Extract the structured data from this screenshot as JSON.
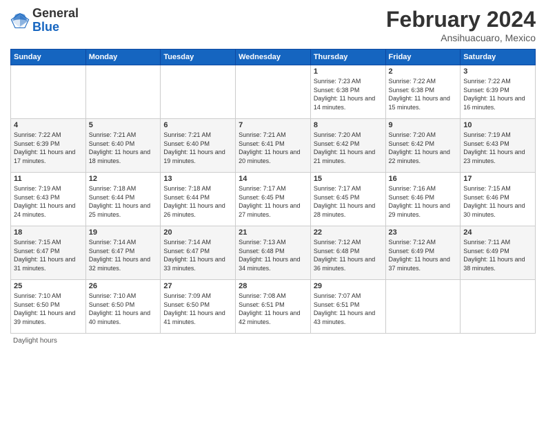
{
  "logo": {
    "general": "General",
    "blue": "Blue"
  },
  "title": "February 2024",
  "subtitle": "Ansihuacuaro, Mexico",
  "days_of_week": [
    "Sunday",
    "Monday",
    "Tuesday",
    "Wednesday",
    "Thursday",
    "Friday",
    "Saturday"
  ],
  "weeks": [
    [
      {
        "num": "",
        "sunrise": "",
        "sunset": "",
        "daylight": ""
      },
      {
        "num": "",
        "sunrise": "",
        "sunset": "",
        "daylight": ""
      },
      {
        "num": "",
        "sunrise": "",
        "sunset": "",
        "daylight": ""
      },
      {
        "num": "",
        "sunrise": "",
        "sunset": "",
        "daylight": ""
      },
      {
        "num": "1",
        "sunrise": "7:23 AM",
        "sunset": "6:38 PM",
        "daylight": "11 hours and 14 minutes."
      },
      {
        "num": "2",
        "sunrise": "7:22 AM",
        "sunset": "6:38 PM",
        "daylight": "11 hours and 15 minutes."
      },
      {
        "num": "3",
        "sunrise": "7:22 AM",
        "sunset": "6:39 PM",
        "daylight": "11 hours and 16 minutes."
      }
    ],
    [
      {
        "num": "4",
        "sunrise": "7:22 AM",
        "sunset": "6:39 PM",
        "daylight": "11 hours and 17 minutes."
      },
      {
        "num": "5",
        "sunrise": "7:21 AM",
        "sunset": "6:40 PM",
        "daylight": "11 hours and 18 minutes."
      },
      {
        "num": "6",
        "sunrise": "7:21 AM",
        "sunset": "6:40 PM",
        "daylight": "11 hours and 19 minutes."
      },
      {
        "num": "7",
        "sunrise": "7:21 AM",
        "sunset": "6:41 PM",
        "daylight": "11 hours and 20 minutes."
      },
      {
        "num": "8",
        "sunrise": "7:20 AM",
        "sunset": "6:42 PM",
        "daylight": "11 hours and 21 minutes."
      },
      {
        "num": "9",
        "sunrise": "7:20 AM",
        "sunset": "6:42 PM",
        "daylight": "11 hours and 22 minutes."
      },
      {
        "num": "10",
        "sunrise": "7:19 AM",
        "sunset": "6:43 PM",
        "daylight": "11 hours and 23 minutes."
      }
    ],
    [
      {
        "num": "11",
        "sunrise": "7:19 AM",
        "sunset": "6:43 PM",
        "daylight": "11 hours and 24 minutes."
      },
      {
        "num": "12",
        "sunrise": "7:18 AM",
        "sunset": "6:44 PM",
        "daylight": "11 hours and 25 minutes."
      },
      {
        "num": "13",
        "sunrise": "7:18 AM",
        "sunset": "6:44 PM",
        "daylight": "11 hours and 26 minutes."
      },
      {
        "num": "14",
        "sunrise": "7:17 AM",
        "sunset": "6:45 PM",
        "daylight": "11 hours and 27 minutes."
      },
      {
        "num": "15",
        "sunrise": "7:17 AM",
        "sunset": "6:45 PM",
        "daylight": "11 hours and 28 minutes."
      },
      {
        "num": "16",
        "sunrise": "7:16 AM",
        "sunset": "6:46 PM",
        "daylight": "11 hours and 29 minutes."
      },
      {
        "num": "17",
        "sunrise": "7:15 AM",
        "sunset": "6:46 PM",
        "daylight": "11 hours and 30 minutes."
      }
    ],
    [
      {
        "num": "18",
        "sunrise": "7:15 AM",
        "sunset": "6:47 PM",
        "daylight": "11 hours and 31 minutes."
      },
      {
        "num": "19",
        "sunrise": "7:14 AM",
        "sunset": "6:47 PM",
        "daylight": "11 hours and 32 minutes."
      },
      {
        "num": "20",
        "sunrise": "7:14 AM",
        "sunset": "6:47 PM",
        "daylight": "11 hours and 33 minutes."
      },
      {
        "num": "21",
        "sunrise": "7:13 AM",
        "sunset": "6:48 PM",
        "daylight": "11 hours and 34 minutes."
      },
      {
        "num": "22",
        "sunrise": "7:12 AM",
        "sunset": "6:48 PM",
        "daylight": "11 hours and 36 minutes."
      },
      {
        "num": "23",
        "sunrise": "7:12 AM",
        "sunset": "6:49 PM",
        "daylight": "11 hours and 37 minutes."
      },
      {
        "num": "24",
        "sunrise": "7:11 AM",
        "sunset": "6:49 PM",
        "daylight": "11 hours and 38 minutes."
      }
    ],
    [
      {
        "num": "25",
        "sunrise": "7:10 AM",
        "sunset": "6:50 PM",
        "daylight": "11 hours and 39 minutes."
      },
      {
        "num": "26",
        "sunrise": "7:10 AM",
        "sunset": "6:50 PM",
        "daylight": "11 hours and 40 minutes."
      },
      {
        "num": "27",
        "sunrise": "7:09 AM",
        "sunset": "6:50 PM",
        "daylight": "11 hours and 41 minutes."
      },
      {
        "num": "28",
        "sunrise": "7:08 AM",
        "sunset": "6:51 PM",
        "daylight": "11 hours and 42 minutes."
      },
      {
        "num": "29",
        "sunrise": "7:07 AM",
        "sunset": "6:51 PM",
        "daylight": "11 hours and 43 minutes."
      },
      {
        "num": "",
        "sunrise": "",
        "sunset": "",
        "daylight": ""
      },
      {
        "num": "",
        "sunrise": "",
        "sunset": "",
        "daylight": ""
      }
    ]
  ],
  "footer": "Daylight hours"
}
